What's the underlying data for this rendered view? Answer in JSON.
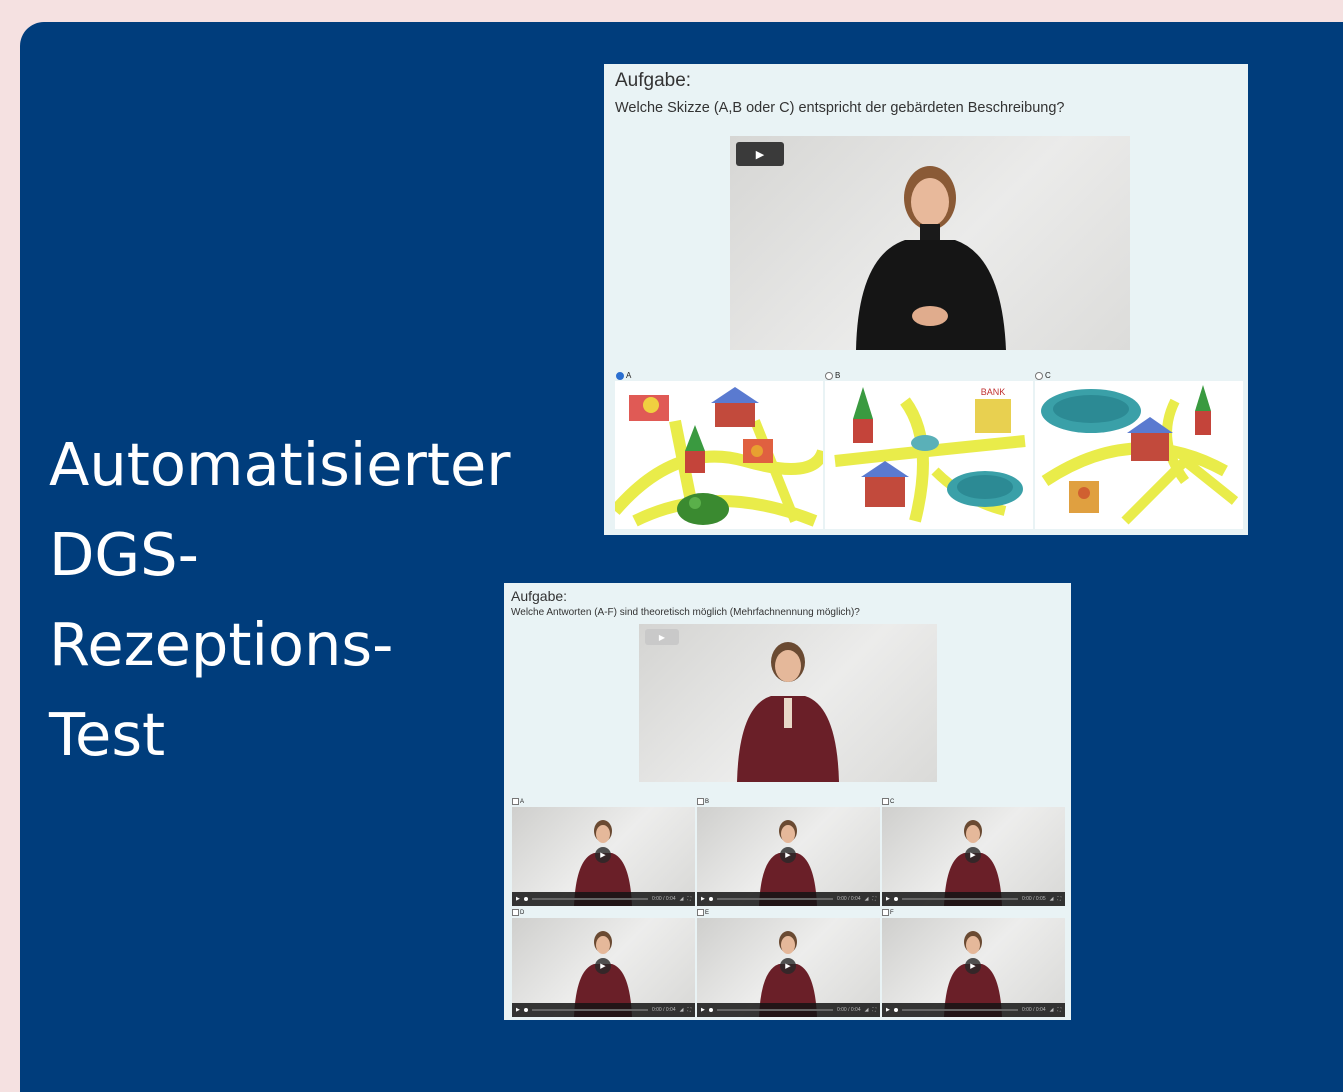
{
  "slide": {
    "title_lines": [
      "Automatisierter",
      "DGS-",
      "Rezeptions-",
      "Test"
    ],
    "background_color": "#003d7c",
    "page_background": "#f5e1e1"
  },
  "panel_top": {
    "heading": "Aufgabe:",
    "question": "Welche Skizze (A,B oder C) entspricht der gebärdeten Beschreibung?",
    "play_icon": "play-icon",
    "options": [
      {
        "label": "A",
        "selected": true
      },
      {
        "label": "B",
        "selected": false
      },
      {
        "label": "C",
        "selected": false
      }
    ],
    "sketch_b_sign": "BANK"
  },
  "panel_bottom": {
    "heading": "Aufgabe:",
    "question": "Welche Antworten (A-F) sind theoretisch möglich (Mehrfachnennung möglich)?",
    "answers": [
      {
        "label": "A",
        "time": "0:00 / 0:04"
      },
      {
        "label": "B",
        "time": "0:00 / 0:04"
      },
      {
        "label": "C",
        "time": "0:00 / 0:05"
      },
      {
        "label": "D",
        "time": "0:00 / 0:04"
      },
      {
        "label": "E",
        "time": "0:00 / 0:04"
      },
      {
        "label": "F",
        "time": "0:00 / 0:04"
      }
    ]
  }
}
